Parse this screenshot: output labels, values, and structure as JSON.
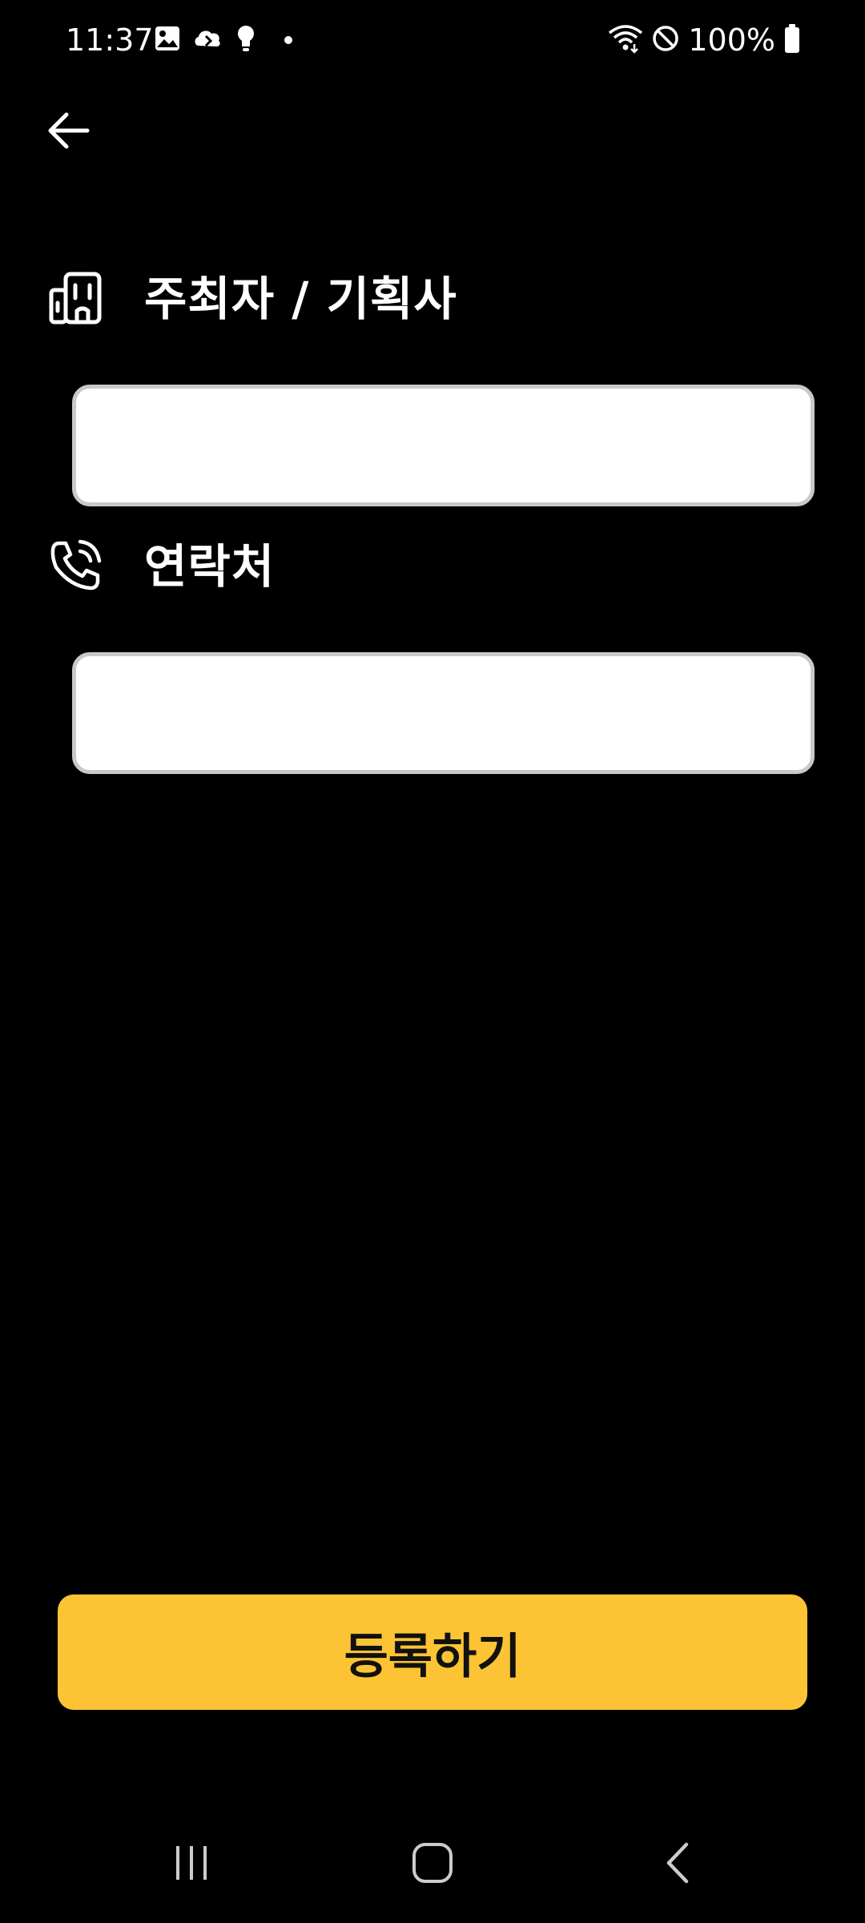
{
  "status_bar": {
    "time": "11:37",
    "battery": "100%",
    "left_icons": [
      "gallery-icon",
      "cloud-sync-icon",
      "lightbulb-icon",
      "dot-icon"
    ],
    "right_icons": [
      "wifi-icon",
      "do-not-disturb-icon",
      "battery-icon"
    ]
  },
  "form": {
    "organizer_label": "주최자 / 기획사",
    "organizer_value": "",
    "contact_label": "연락처",
    "contact_value": ""
  },
  "submit_button": {
    "label": "등록하기",
    "color": "#fcc434"
  },
  "nav_bar": {
    "items": [
      "recent-apps-icon",
      "home-icon",
      "back-icon"
    ]
  }
}
